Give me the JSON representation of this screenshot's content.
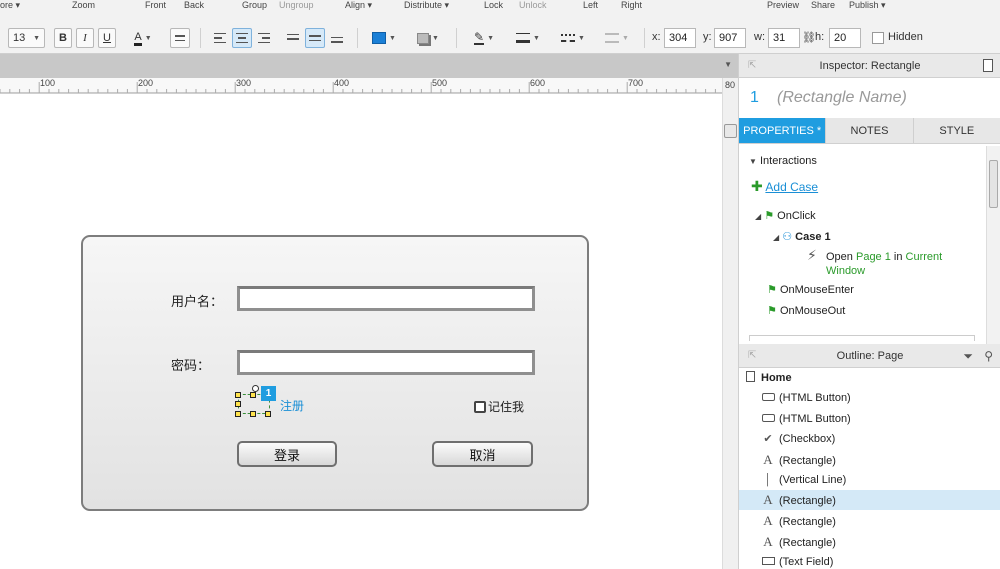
{
  "menubar": {
    "more": "ore ▾",
    "zoom": "Zoom",
    "front": "Front",
    "back": "Back",
    "group": "Group",
    "ungroup": "Ungroup",
    "align": "Align ▾",
    "distribute": "Distribute ▾",
    "lock": "Lock",
    "unlock": "Unlock",
    "left": "Left",
    "right": "Right",
    "preview": "Preview",
    "share": "Share",
    "publish": "Publish ▾"
  },
  "toolbar": {
    "font_size": "13",
    "bold": "B",
    "italic": "I",
    "underline": "U",
    "font_color": "A",
    "fill_color": "#1a7fd6",
    "x_label": "x:",
    "x_value": "304",
    "y_label": "y:",
    "y_value": "907",
    "w_label": "w:",
    "w_value": "31",
    "h_label": "h:",
    "h_value": "20",
    "hidden_label": "Hidden"
  },
  "ruler": {
    "ticks": [
      "100",
      "200",
      "300",
      "400",
      "500",
      "600",
      "700",
      "80"
    ]
  },
  "login": {
    "username_label": "用户名：",
    "password_label": "密码：",
    "register_link": "注册",
    "remember_label": "记住我",
    "login_button": "登录",
    "cancel_button": "取消",
    "selection_badge": "1"
  },
  "inspector": {
    "title": "Inspector: Rectangle",
    "page_number": "1",
    "name_placeholder": "(Rectangle Name)",
    "tabs": [
      "PROPERTIES *",
      "NOTES",
      "STYLE"
    ],
    "section": "Interactions",
    "add_case": "Add Case",
    "onclick": "OnClick",
    "case_name": "Case 1",
    "action_open": "Open",
    "action_page": "Page 1",
    "action_in": "in",
    "action_target": "Current",
    "action_target2": "Window",
    "on_mouse_enter": "OnMouseEnter",
    "on_mouse_out": "OnMouseOut"
  },
  "outline": {
    "title": "Outline: Page",
    "home": "Home",
    "items": [
      "(HTML Button)",
      "(HTML Button)",
      "(Checkbox)",
      "(Rectangle)",
      "(Vertical Line)",
      "(Rectangle)",
      "(Rectangle)",
      "(Rectangle)",
      "(Text Field)"
    ]
  },
  "colors": {
    "accent": "#1f9de0",
    "link": "#1a8fd6",
    "action_green": "#2a9a2a"
  }
}
